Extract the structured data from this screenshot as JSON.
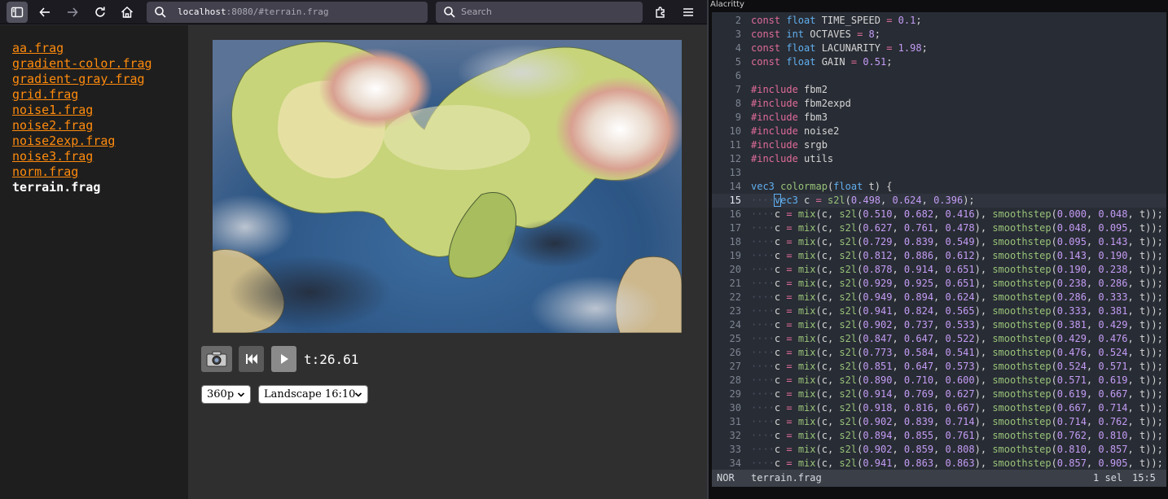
{
  "browser": {
    "url_host": "localhost",
    "url_rest": ":8080/#terrain.frag",
    "search_placeholder": "Search",
    "files": [
      {
        "label": "aa.frag",
        "current": false
      },
      {
        "label": "gradient-color.frag",
        "current": false
      },
      {
        "label": "gradient-gray.frag",
        "current": false
      },
      {
        "label": "grid.frag",
        "current": false
      },
      {
        "label": "noise1.frag",
        "current": false
      },
      {
        "label": "noise2.frag",
        "current": false
      },
      {
        "label": "noise2exp.frag",
        "current": false
      },
      {
        "label": "noise3.frag",
        "current": false
      },
      {
        "label": "norm.frag",
        "current": false
      },
      {
        "label": "terrain.frag",
        "current": true
      }
    ],
    "controls": {
      "time": "t:26.61",
      "resolution": "360p",
      "aspect": "Landscape 16:10"
    },
    "icons": {
      "sidebar": "sidebar-icon",
      "back": "back-arrow-icon",
      "forward": "forward-arrow-icon",
      "reload": "reload-icon",
      "home": "home-icon",
      "extensions": "puzzle-icon",
      "menu": "hamburger-menu-icon",
      "camera": "camera-icon",
      "rewind": "rewind-icon",
      "play": "play-icon"
    }
  },
  "terminal": {
    "title": "Alacritty",
    "status": {
      "mode": "NOR",
      "file": "terrain.frag",
      "selections": "1 sel",
      "position": "15:5"
    },
    "lines": [
      {
        "n": "2",
        "t": "const float TIME_SPEED = 0.1;"
      },
      {
        "n": "3",
        "t": "const int OCTAVES = 8;"
      },
      {
        "n": "4",
        "t": "const float LACUNARITY = 1.98;"
      },
      {
        "n": "5",
        "t": "const float GAIN = 0.51;"
      },
      {
        "n": "6",
        "t": ""
      },
      {
        "n": "7",
        "t": "#include fbm2"
      },
      {
        "n": "8",
        "t": "#include fbm2expd"
      },
      {
        "n": "9",
        "t": "#include fbm3"
      },
      {
        "n": "10",
        "t": "#include noise2"
      },
      {
        "n": "11",
        "t": "#include srgb"
      },
      {
        "n": "12",
        "t": "#include utils"
      },
      {
        "n": "13",
        "t": ""
      },
      {
        "n": "14",
        "t": "vec3 colormap(float t) {"
      },
      {
        "n": "15",
        "t": "    vec3 c = s2l(0.498, 0.624, 0.396);"
      },
      {
        "n": "16",
        "t": "    c = mix(c, s2l(0.510, 0.682, 0.416), smoothstep(0.000, 0.048, t));"
      },
      {
        "n": "17",
        "t": "    c = mix(c, s2l(0.627, 0.761, 0.478), smoothstep(0.048, 0.095, t));"
      },
      {
        "n": "18",
        "t": "    c = mix(c, s2l(0.729, 0.839, 0.549), smoothstep(0.095, 0.143, t));"
      },
      {
        "n": "19",
        "t": "    c = mix(c, s2l(0.812, 0.886, 0.612), smoothstep(0.143, 0.190, t));"
      },
      {
        "n": "20",
        "t": "    c = mix(c, s2l(0.878, 0.914, 0.651), smoothstep(0.190, 0.238, t));"
      },
      {
        "n": "21",
        "t": "    c = mix(c, s2l(0.929, 0.925, 0.651), smoothstep(0.238, 0.286, t));"
      },
      {
        "n": "22",
        "t": "    c = mix(c, s2l(0.949, 0.894, 0.624), smoothstep(0.286, 0.333, t));"
      },
      {
        "n": "23",
        "t": "    c = mix(c, s2l(0.941, 0.824, 0.565), smoothstep(0.333, 0.381, t));"
      },
      {
        "n": "24",
        "t": "    c = mix(c, s2l(0.902, 0.737, 0.533), smoothstep(0.381, 0.429, t));"
      },
      {
        "n": "25",
        "t": "    c = mix(c, s2l(0.847, 0.647, 0.522), smoothstep(0.429, 0.476, t));"
      },
      {
        "n": "26",
        "t": "    c = mix(c, s2l(0.773, 0.584, 0.541), smoothstep(0.476, 0.524, t));"
      },
      {
        "n": "27",
        "t": "    c = mix(c, s2l(0.851, 0.647, 0.573), smoothstep(0.524, 0.571, t));"
      },
      {
        "n": "28",
        "t": "    c = mix(c, s2l(0.890, 0.710, 0.600), smoothstep(0.571, 0.619, t));"
      },
      {
        "n": "29",
        "t": "    c = mix(c, s2l(0.914, 0.769, 0.627), smoothstep(0.619, 0.667, t));"
      },
      {
        "n": "30",
        "t": "    c = mix(c, s2l(0.918, 0.816, 0.667), smoothstep(0.667, 0.714, t));"
      },
      {
        "n": "31",
        "t": "    c = mix(c, s2l(0.902, 0.839, 0.714), smoothstep(0.714, 0.762, t));"
      },
      {
        "n": "32",
        "t": "    c = mix(c, s2l(0.894, 0.855, 0.761), smoothstep(0.762, 0.810, t));"
      },
      {
        "n": "33",
        "t": "    c = mix(c, s2l(0.902, 0.859, 0.808), smoothstep(0.810, 0.857, t));"
      },
      {
        "n": "34",
        "t": "    c = mix(c, s2l(0.941, 0.863, 0.863), smoothstep(0.857, 0.905, t));"
      }
    ],
    "cursor_line": "15"
  },
  "colors": {
    "link": "#ff8b0d",
    "editor_bg": "#282c34",
    "keyword": "#e06c9a",
    "type": "#61afef",
    "number": "#c49cf5",
    "function": "#98c379"
  }
}
